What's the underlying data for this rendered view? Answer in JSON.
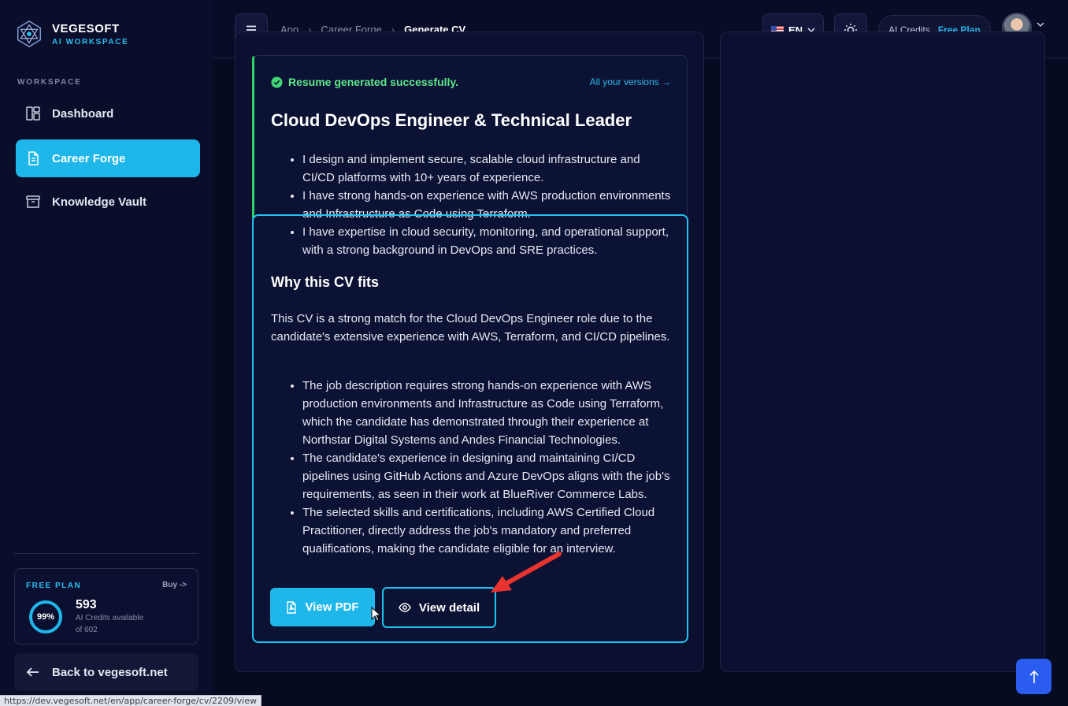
{
  "brand": {
    "name": "VEGESOFT",
    "subtitle": "AI WORKSPACE"
  },
  "sidebar": {
    "section_label": "WORKSPACE",
    "items": [
      {
        "label": "Dashboard",
        "icon": "dashboard-icon",
        "active": false
      },
      {
        "label": "Career Forge",
        "icon": "document-icon",
        "active": true
      },
      {
        "label": "Knowledge Vault",
        "icon": "archive-icon",
        "active": false
      }
    ],
    "plan": {
      "title": "FREE PLAN",
      "buy_label": "Buy ->",
      "percent_label": "99%",
      "percent": 99,
      "credits": "593",
      "credits_line1": "AI Credits available",
      "credits_line2": "of 602"
    },
    "back_label": "Back to vegesoft.net"
  },
  "header": {
    "breadcrumbs": [
      "App",
      "Career Forge",
      "Generate CV"
    ],
    "lang": "EN",
    "ai_credits_label": "AI Credits",
    "plan_label": "Free Plan"
  },
  "result": {
    "success_text": "Resume generated successfully.",
    "versions_link": "All your versions →",
    "title": "Cloud DevOps Engineer & Technical Leader",
    "summary_points": [
      "I design and implement secure, scalable cloud infrastructure and CI/CD platforms with 10+ years of experience.",
      "I have strong hands-on experience with AWS production environments and Infrastructure as Code using Terraform.",
      "I have expertise in cloud security, monitoring, and operational support, with a strong background in DevOps and SRE practices."
    ],
    "why_title": "Why this CV fits",
    "why_paragraph": "This CV is a strong match for the Cloud DevOps Engineer role due to the candidate's extensive experience with AWS, Terraform, and CI/CD pipelines.",
    "why_points": [
      "The job description requires strong hands-on experience with AWS production environments and Infrastructure as Code using Terraform, which the candidate has demonstrated through their experience at Northstar Digital Systems and Andes Financial Technologies.",
      "The candidate's experience in designing and maintaining CI/CD pipelines using GitHub Actions and Azure DevOps aligns with the job's requirements, as seen in their work at BlueRiver Commerce Labs.",
      "The selected skills and certifications, including AWS Certified Cloud Practitioner, directly address the job's mandatory and preferred qualifications, making the candidate eligible for an interview."
    ],
    "view_pdf_label": "View PDF",
    "view_detail_label": "View detail"
  },
  "status_url": "https://dev.vegesoft.net/en/app/career-forge/cv/2209/view",
  "colors": {
    "accent": "#1fb6ea",
    "success": "#5ee88b",
    "background": "#070b22",
    "highlight": "#1fc4ee",
    "annotation_arrow": "#e8332f"
  }
}
